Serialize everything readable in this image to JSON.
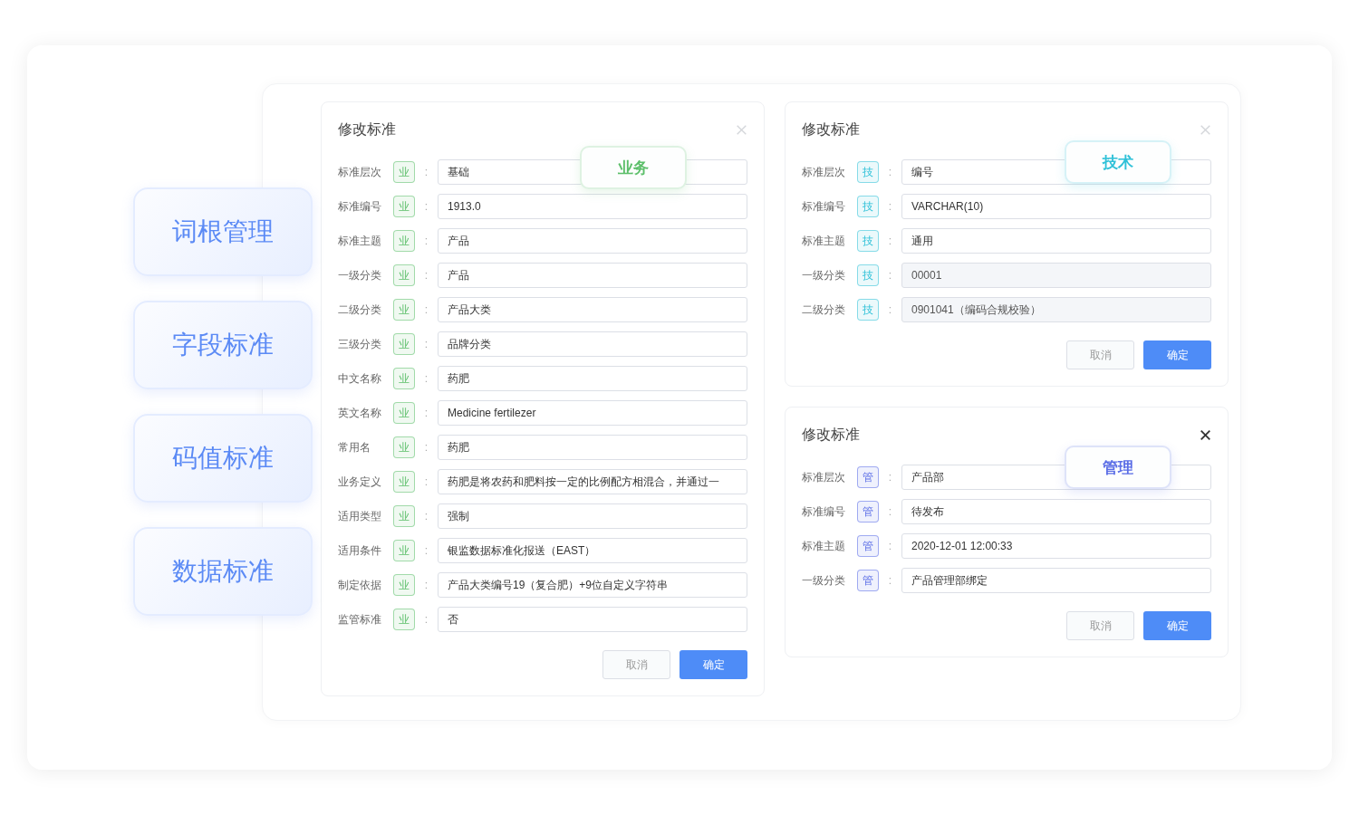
{
  "nav_items": [
    "词根管理",
    "字段标准",
    "码值标准",
    "数据标准"
  ],
  "dialogs": [
    {
      "title": "修改标准",
      "badge": "业务",
      "color": "#5cbf6a",
      "close_emphasized": false,
      "fields": [
        {
          "label": "标准层次",
          "tag": "业",
          "colon": ":",
          "value": "基础",
          "disabled": false
        },
        {
          "label": "标准编号",
          "tag": "业",
          "colon": ":",
          "value": "1913.0",
          "disabled": false
        },
        {
          "label": "标准主题",
          "tag": "业",
          "colon": ":",
          "value": "产品",
          "disabled": false
        },
        {
          "label": "一级分类",
          "tag": "业",
          "colon": ":",
          "value": "产品",
          "disabled": false
        },
        {
          "label": "二级分类",
          "tag": "业",
          "colon": ":",
          "value": "产品大类",
          "disabled": false
        },
        {
          "label": "三级分类",
          "tag": "业",
          "colon": ":",
          "value": "品牌分类",
          "disabled": false
        },
        {
          "label": "中文名称",
          "tag": "业",
          "colon": ":",
          "value": "药肥",
          "disabled": false
        },
        {
          "label": "英文名称",
          "tag": "业",
          "colon": ":",
          "value": "Medicine fertilezer",
          "disabled": false
        },
        {
          "label": "常用名",
          "tag": "业",
          "colon": ":",
          "value": "药肥",
          "disabled": false
        },
        {
          "label": "业务定义",
          "tag": "业",
          "colon": ":",
          "value": "药肥是将农药和肥料按一定的比例配方相混合，并通过一",
          "disabled": false
        },
        {
          "label": "适用类型",
          "tag": "业",
          "colon": ":",
          "value": "强制",
          "disabled": false
        },
        {
          "label": "适用条件",
          "tag": "业",
          "colon": ":",
          "value": "银监数据标准化报送（EAST）",
          "disabled": false
        },
        {
          "label": "制定依据",
          "tag": "业",
          "colon": ":",
          "value": "产品大类编号19（复合肥）+9位自定义字符串",
          "disabled": false
        },
        {
          "label": "监管标准",
          "tag": "业",
          "colon": ":",
          "value": "否",
          "disabled": false
        }
      ],
      "buttons": {
        "cancel": "取消",
        "confirm": "确定"
      }
    },
    {
      "title": "修改标准",
      "badge": "技术",
      "color": "#2fc1d8",
      "close_emphasized": false,
      "fields": [
        {
          "label": "标准层次",
          "tag": "技",
          "colon": ":",
          "value": "编号",
          "disabled": false
        },
        {
          "label": "标准编号",
          "tag": "技",
          "colon": ":",
          "value": "VARCHAR(10)",
          "disabled": false
        },
        {
          "label": "标准主题",
          "tag": "技",
          "colon": ":",
          "value": "通用",
          "disabled": false
        },
        {
          "label": "一级分类",
          "tag": "技",
          "colon": ":",
          "value": "00001",
          "disabled": true
        },
        {
          "label": "二级分类",
          "tag": "技",
          "colon": ":",
          "value": "0901041（编码合规校验）",
          "disabled": true
        }
      ],
      "buttons": {
        "cancel": "取消",
        "confirm": "确定"
      }
    },
    {
      "title": "修改标准",
      "badge": "管理",
      "color": "#5a6de6",
      "close_emphasized": true,
      "fields": [
        {
          "label": "标准层次",
          "tag": "管",
          "colon": ":",
          "value": "产品部",
          "disabled": false
        },
        {
          "label": "标准编号",
          "tag": "管",
          "colon": ":",
          "value": "待发布",
          "disabled": false
        },
        {
          "label": "标准主题",
          "tag": "管",
          "colon": ":",
          "value": "2020-12-01 12:00:33",
          "disabled": false
        },
        {
          "label": "一级分类",
          "tag": "管",
          "colon": ":",
          "value": "产品管理部绑定",
          "disabled": false
        }
      ],
      "buttons": {
        "cancel": "取消",
        "confirm": "确定"
      }
    }
  ]
}
